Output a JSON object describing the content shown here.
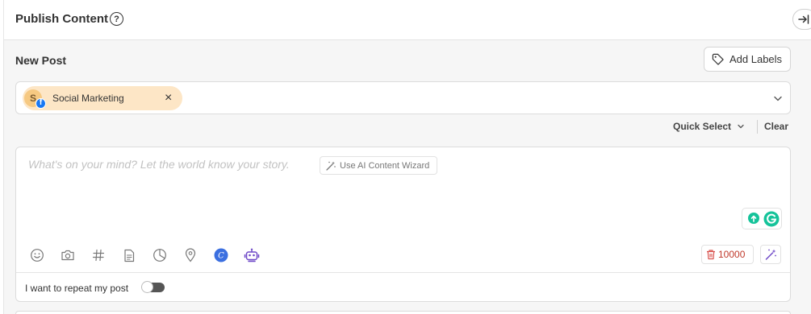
{
  "header": {
    "title": "Publish Content",
    "help_icon": "question-circle-icon",
    "collapse_icon": "arrow-right-to-line-icon"
  },
  "post": {
    "section_title": "New Post",
    "add_labels": "Add Labels",
    "add_labels_icon": "tag-icon"
  },
  "accounts": {
    "selected": [
      {
        "label": "Social Marketing",
        "avatar_letter": "S",
        "network_badge": "f",
        "network": "facebook"
      }
    ],
    "chevron_icon": "chevron-down-icon"
  },
  "quick_select": {
    "label": "Quick Select",
    "clear": "Clear"
  },
  "editor": {
    "placeholder": "What's on your mind? Let the world know your story.",
    "ai_wizard": "Use AI Content Wizard",
    "char_count": "10000",
    "repeat_label": "I want to repeat my post",
    "repeat_enabled": false,
    "toolbar_icons": [
      "emoji-icon",
      "camera-icon",
      "hashtag-icon",
      "document-icon",
      "pie-chart-icon",
      "location-pin-icon",
      "canva-icon",
      "robot-icon"
    ],
    "canva_letter": "C"
  },
  "colors": {
    "chip_bg": "#fde6c6",
    "facebook": "#1877f2",
    "grammarly": "#15c39a",
    "canva": "#3b6fe0",
    "robot": "#6f49c8",
    "counter": "#c0392b"
  }
}
